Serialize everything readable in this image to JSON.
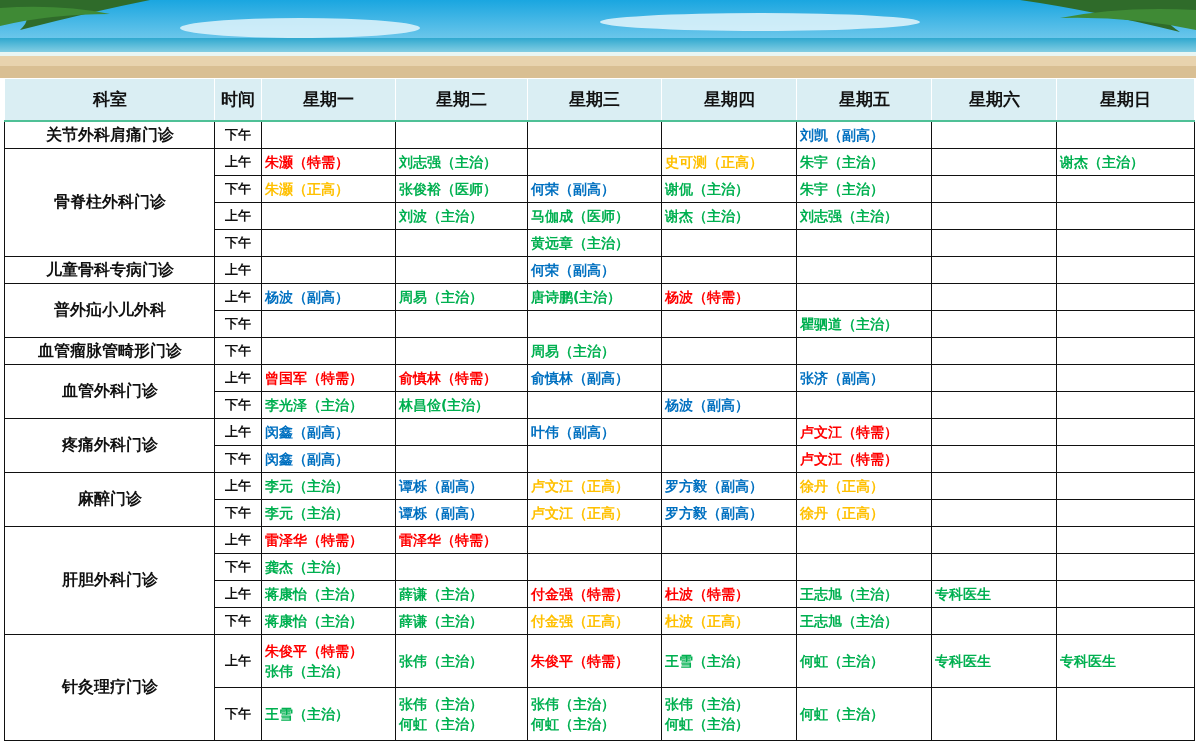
{
  "table": {
    "columns": [
      "科室",
      "时间",
      "星期一",
      "星期二",
      "星期三",
      "星期四",
      "星期五",
      "星期六",
      "星期日"
    ],
    "departments": [
      {
        "name": "关节外科肩痛门诊",
        "rows": [
          {
            "time": "下午",
            "cells": [
              [],
              [],
              [],
              [],
              [
                {
                  "text": "刘凯（副高）",
                  "color": "#0070c0"
                }
              ],
              [],
              []
            ]
          }
        ]
      },
      {
        "name": "骨脊柱外科门诊",
        "rows": [
          {
            "time": "上午",
            "cells": [
              [
                {
                  "text": "朱灏（特需）",
                  "color": "#ff0000"
                }
              ],
              [
                {
                  "text": "刘志强（主治）",
                  "color": "#00b050"
                }
              ],
              [],
              [
                {
                  "text": "史可测（正高）",
                  "color": "#ffc000"
                }
              ],
              [
                {
                  "text": "朱宇（主治）",
                  "color": "#00b050"
                }
              ],
              [],
              [
                {
                  "text": "谢杰（主治）",
                  "color": "#00b050"
                }
              ]
            ]
          },
          {
            "time": "下午",
            "cells": [
              [
                {
                  "text": "朱灏（正高）",
                  "color": "#ffc000"
                }
              ],
              [
                {
                  "text": "张俊裕（医师）",
                  "color": "#00b050"
                }
              ],
              [
                {
                  "text": "何荣（副高）",
                  "color": "#0070c0"
                }
              ],
              [
                {
                  "text": "谢侃（主治）",
                  "color": "#00b050"
                }
              ],
              [
                {
                  "text": "朱宇（主治）",
                  "color": "#00b050"
                }
              ],
              [],
              []
            ]
          },
          {
            "time": "上午",
            "cells": [
              [],
              [
                {
                  "text": "刘波（主治）",
                  "color": "#00b050"
                }
              ],
              [
                {
                  "text": "马伽成（医师）",
                  "color": "#00b050"
                }
              ],
              [
                {
                  "text": "谢杰（主治）",
                  "color": "#00b050"
                }
              ],
              [
                {
                  "text": "刘志强（主治）",
                  "color": "#00b050"
                }
              ],
              [],
              []
            ]
          },
          {
            "time": "下午",
            "cells": [
              [],
              [],
              [
                {
                  "text": "黄远章（主治）",
                  "color": "#00b050"
                }
              ],
              [],
              [],
              [],
              []
            ]
          }
        ]
      },
      {
        "name": "儿童骨科专病门诊",
        "rows": [
          {
            "time": "上午",
            "cells": [
              [],
              [],
              [
                {
                  "text": "何荣（副高）",
                  "color": "#0070c0"
                }
              ],
              [],
              [],
              [],
              []
            ]
          }
        ]
      },
      {
        "name": "普外疝小儿外科",
        "rows": [
          {
            "time": "上午",
            "cells": [
              [
                {
                  "text": "杨波（副高）",
                  "color": "#0070c0"
                }
              ],
              [
                {
                  "text": "周易（主治）",
                  "color": "#00b050"
                }
              ],
              [
                {
                  "text": "唐诗鹏(主治）",
                  "color": "#00b050"
                }
              ],
              [
                {
                  "text": "杨波（特需）",
                  "color": "#ff0000"
                }
              ],
              [],
              [],
              []
            ]
          },
          {
            "time": "下午",
            "cells": [
              [],
              [],
              [],
              [],
              [
                {
                  "text": "瞿驷道（主治）",
                  "color": "#00b050"
                }
              ],
              [],
              []
            ]
          }
        ]
      },
      {
        "name": "血管瘤脉管畸形门诊",
        "rows": [
          {
            "time": "下午",
            "cells": [
              [],
              [],
              [
                {
                  "text": "周易（主治）",
                  "color": "#00b050"
                }
              ],
              [],
              [],
              [],
              []
            ]
          }
        ]
      },
      {
        "name": "血管外科门诊",
        "rows": [
          {
            "time": "上午",
            "cells": [
              [
                {
                  "text": "曾国军（特需）",
                  "color": "#ff0000"
                }
              ],
              [
                {
                  "text": "俞慎林（特需）",
                  "color": "#ff0000"
                }
              ],
              [
                {
                  "text": "俞慎林（副高）",
                  "color": "#0070c0"
                }
              ],
              [],
              [
                {
                  "text": "张济（副高）",
                  "color": "#0070c0"
                }
              ],
              [],
              []
            ]
          },
          {
            "time": "下午",
            "cells": [
              [
                {
                  "text": "李光泽（主治）",
                  "color": "#00b050"
                }
              ],
              [
                {
                  "text": "林昌俭(主治）",
                  "color": "#00b050"
                }
              ],
              [],
              [
                {
                  "text": "杨波（副高）",
                  "color": "#0070c0"
                }
              ],
              [],
              [],
              []
            ]
          }
        ]
      },
      {
        "name": "疼痛外科门诊",
        "rows": [
          {
            "time": "上午",
            "cells": [
              [
                {
                  "text": "闵鑫（副高）",
                  "color": "#0070c0"
                }
              ],
              [],
              [
                {
                  "text": "叶伟（副高）",
                  "color": "#0070c0"
                }
              ],
              [],
              [
                {
                  "text": "卢文江（特需）",
                  "color": "#ff0000"
                }
              ],
              [],
              []
            ]
          },
          {
            "time": "下午",
            "cells": [
              [
                {
                  "text": "闵鑫（副高）",
                  "color": "#0070c0"
                }
              ],
              [],
              [],
              [],
              [
                {
                  "text": "卢文江（特需）",
                  "color": "#ff0000"
                }
              ],
              [],
              []
            ]
          }
        ]
      },
      {
        "name": "麻醉门诊",
        "rows": [
          {
            "time": "上午",
            "cells": [
              [
                {
                  "text": "李元（主治）",
                  "color": "#00b050"
                }
              ],
              [
                {
                  "text": "谭栎（副高）",
                  "color": "#0070c0"
                }
              ],
              [
                {
                  "text": "卢文江（正高）",
                  "color": "#ffc000"
                }
              ],
              [
                {
                  "text": "罗方毅（副高）",
                  "color": "#0070c0"
                }
              ],
              [
                {
                  "text": "徐丹（正高）",
                  "color": "#ffc000"
                }
              ],
              [],
              []
            ]
          },
          {
            "time": "下午",
            "cells": [
              [
                {
                  "text": "李元（主治）",
                  "color": "#00b050"
                }
              ],
              [
                {
                  "text": "谭栎（副高）",
                  "color": "#0070c0"
                }
              ],
              [
                {
                  "text": "卢文江（正高）",
                  "color": "#ffc000"
                }
              ],
              [
                {
                  "text": "罗方毅（副高）",
                  "color": "#0070c0"
                }
              ],
              [
                {
                  "text": "徐丹（正高）",
                  "color": "#ffc000"
                }
              ],
              [],
              []
            ]
          }
        ]
      },
      {
        "name": "肝胆外科门诊",
        "rows": [
          {
            "time": "上午",
            "cells": [
              [
                {
                  "text": "雷泽华（特需）",
                  "color": "#ff0000"
                }
              ],
              [
                {
                  "text": "雷泽华（特需）",
                  "color": "#ff0000"
                }
              ],
              [],
              [],
              [],
              [],
              []
            ]
          },
          {
            "time": "下午",
            "cells": [
              [
                {
                  "text": "龚杰（主治）",
                  "color": "#00b050"
                }
              ],
              [],
              [],
              [],
              [],
              [],
              []
            ]
          },
          {
            "time": "上午",
            "cells": [
              [
                {
                  "text": "蒋康怡（主治）",
                  "color": "#00b050"
                }
              ],
              [
                {
                  "text": "薛谦（主治）",
                  "color": "#00b050"
                }
              ],
              [
                {
                  "text": "付金强（特需）",
                  "color": "#ff0000"
                }
              ],
              [
                {
                  "text": "杜波（特需）",
                  "color": "#ff0000"
                }
              ],
              [
                {
                  "text": "王志旭（主治）",
                  "color": "#00b050"
                }
              ],
              [
                {
                  "text": "专科医生",
                  "color": "#00b050"
                }
              ],
              []
            ]
          },
          {
            "time": "下午",
            "cells": [
              [
                {
                  "text": "蒋康怡（主治）",
                  "color": "#00b050"
                }
              ],
              [
                {
                  "text": "薛谦（主治）",
                  "color": "#00b050"
                }
              ],
              [
                {
                  "text": "付金强（正高）",
                  "color": "#ffc000"
                }
              ],
              [
                {
                  "text": "杜波（正高）",
                  "color": "#ffc000"
                }
              ],
              [
                {
                  "text": "王志旭（主治）",
                  "color": "#00b050"
                }
              ],
              [],
              []
            ]
          }
        ]
      },
      {
        "name": "针灸理疗门诊",
        "rows": [
          {
            "time": "上午",
            "cells": [
              [
                {
                  "text": "朱俊平（特需）",
                  "color": "#ff0000"
                },
                {
                  "text": "张伟（主治）",
                  "color": "#00b050"
                }
              ],
              [
                {
                  "text": "张伟（主治）",
                  "color": "#00b050"
                }
              ],
              [
                {
                  "text": "朱俊平（特需）",
                  "color": "#ff0000"
                }
              ],
              [
                {
                  "text": "王雪（主治）",
                  "color": "#00b050"
                }
              ],
              [
                {
                  "text": "何虹（主治）",
                  "color": "#00b050"
                }
              ],
              [
                {
                  "text": "专科医生",
                  "color": "#00b050"
                }
              ],
              [
                {
                  "text": "专科医生",
                  "color": "#00b050"
                }
              ]
            ]
          },
          {
            "time": "下午",
            "cells": [
              [
                {
                  "text": "王雪（主治）",
                  "color": "#00b050"
                }
              ],
              [
                {
                  "text": "张伟（主治）",
                  "color": "#00b050"
                },
                {
                  "text": "何虹（主治）",
                  "color": "#00b050"
                }
              ],
              [
                {
                  "text": "张伟（主治）",
                  "color": "#00b050"
                },
                {
                  "text": "何虹（主治）",
                  "color": "#00b050"
                }
              ],
              [
                {
                  "text": "张伟（主治）",
                  "color": "#00b050"
                },
                {
                  "text": "何虹（主治）",
                  "color": "#00b050"
                }
              ],
              [
                {
                  "text": "何虹（主治）",
                  "color": "#00b050"
                }
              ],
              [],
              []
            ]
          }
        ]
      }
    ]
  }
}
